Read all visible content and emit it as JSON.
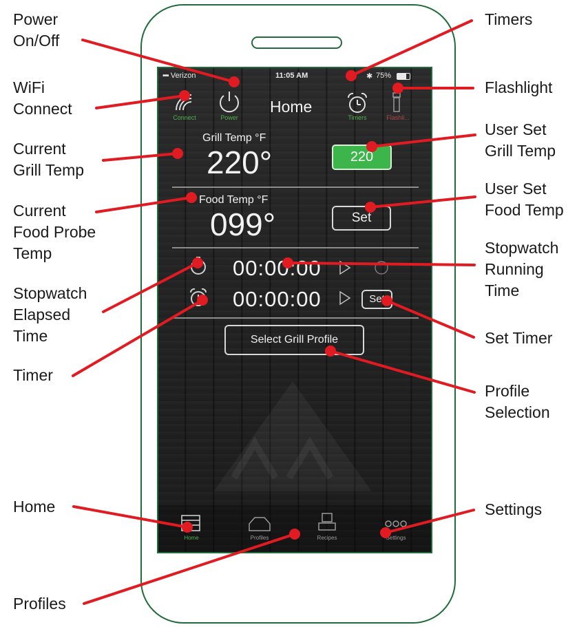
{
  "callouts": {
    "power": "Power\nOn/Off",
    "wifi": "WiFi\nConnect",
    "current_grill_temp": "Current\nGrill Temp",
    "current_food_temp": "Current\nFood Probe\nTemp",
    "stopwatch_elapsed": "Stopwatch\nElapsed\nTime",
    "timer": "Timer",
    "home": "Home",
    "profiles": "Profiles",
    "timers": "Timers",
    "flashlight": "Flashlight",
    "user_set_grill": "User Set\nGrill Temp",
    "user_set_food": "User Set\nFood Temp",
    "stopwatch_running": "Stopwatch\nRunning\nTime",
    "set_timer": "Set Timer",
    "profile_selection": "Profile\nSelection",
    "settings": "Settings"
  },
  "status_bar": {
    "carrier": "Verizon",
    "time": "11:05 AM",
    "battery": "75%"
  },
  "top_bar": {
    "title": "Home",
    "connect_label": "Connect",
    "power_label": "Power",
    "timers_label": "Timers",
    "flash_label": "Flashli..."
  },
  "grill": {
    "label": "Grill Temp °F",
    "value": "220°",
    "set_value": "220"
  },
  "food": {
    "label": "Food Temp °F",
    "value": "099°",
    "set_label": "Set"
  },
  "stopwatch": {
    "time": "00:00:00"
  },
  "timer": {
    "time": "00:00:00",
    "set_label": "Set"
  },
  "profile_button": "Select Grill Profile",
  "tab_bar": {
    "home": "Home",
    "profiles": "Profiles",
    "recipes": "Recipes",
    "settings": "Settings"
  },
  "colors": {
    "phone_outline": "#1f6b3a",
    "leader_line": "#e11b22",
    "accent_green": "#3cb54a"
  }
}
